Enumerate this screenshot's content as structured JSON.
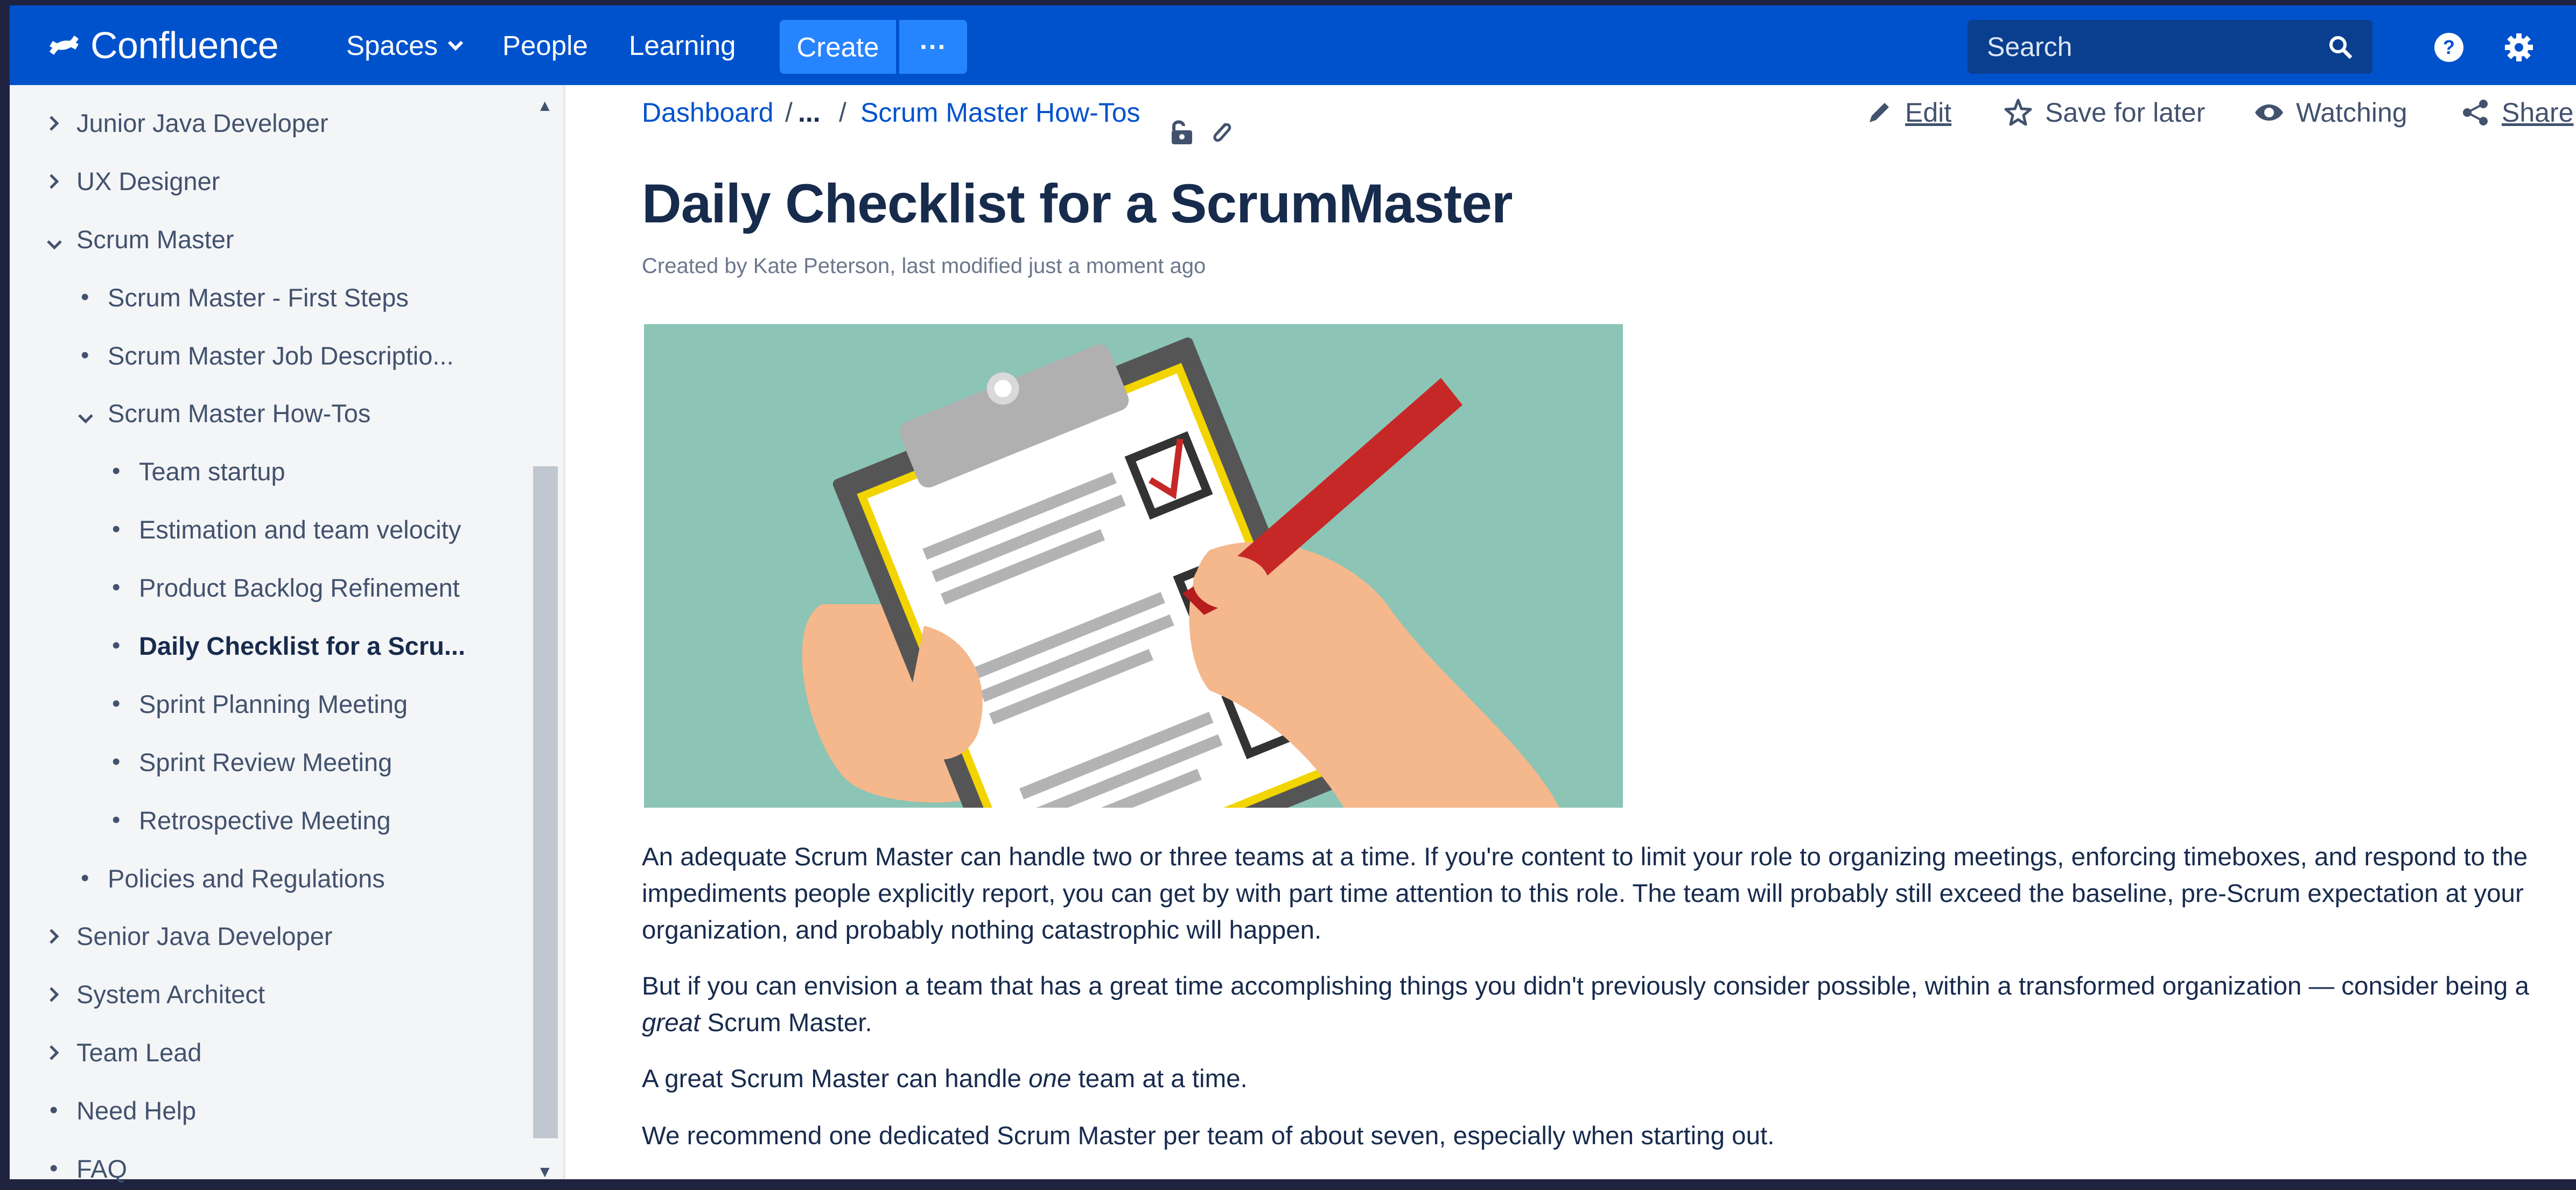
{
  "app": {
    "name": "Confluence",
    "brand_color": "#0052cc",
    "accent_color": "#2684ff"
  },
  "topnav": {
    "items": [
      {
        "label": "Spaces",
        "has_dropdown": true
      },
      {
        "label": "People"
      },
      {
        "label": "Learning"
      }
    ],
    "create_label": "Create",
    "more_label": "···",
    "search_placeholder": "Search",
    "icons": [
      "search-icon",
      "help-icon",
      "settings-icon"
    ]
  },
  "sidebar": {
    "items": [
      {
        "label": "Junior Java Developer",
        "marker": "chevron-right"
      },
      {
        "label": "UX Designer",
        "marker": "chevron-right"
      },
      {
        "label": "Scrum Master",
        "marker": "chevron-down"
      },
      {
        "label": "Scrum Master - First Steps",
        "marker": "bullet"
      },
      {
        "label": "Scrum Master Job Descriptio...",
        "marker": "bullet"
      },
      {
        "label": "Scrum Master How-Tos",
        "marker": "chevron-down"
      },
      {
        "label": "Team startup",
        "marker": "bullet"
      },
      {
        "label": "Estimation and team velocity",
        "marker": "bullet"
      },
      {
        "label": "Product Backlog Refinement",
        "marker": "bullet"
      },
      {
        "label": "Daily Checklist for a Scru...",
        "marker": "bullet",
        "current": true
      },
      {
        "label": "Sprint Planning Meeting",
        "marker": "bullet"
      },
      {
        "label": "Sprint Review Meeting",
        "marker": "bullet"
      },
      {
        "label": "Retrospective Meeting",
        "marker": "bullet"
      },
      {
        "label": "Policies and Regulations",
        "marker": "bullet"
      },
      {
        "label": "Senior Java Developer",
        "marker": "chevron-right"
      },
      {
        "label": "System Architect",
        "marker": "chevron-right"
      },
      {
        "label": "Team Lead",
        "marker": "chevron-right"
      },
      {
        "label": "Need Help",
        "marker": "bullet"
      },
      {
        "label": "FAQ",
        "marker": "bullet"
      }
    ]
  },
  "breadcrumb": {
    "items": [
      "Dashboard",
      "...",
      "Scrum Master How-Tos"
    ],
    "separator": "/"
  },
  "page_actions": {
    "edit": "Edit",
    "save_for_later": "Save for later",
    "watching": "Watching",
    "share": "Share"
  },
  "page": {
    "title": "Daily Checklist for a ScrumMaster",
    "byline": "Created by Kate Peterson, last modified just a moment ago",
    "paragraphs": [
      "An adequate Scrum Master can handle two or three teams at a time. If you're content to limit your role to organizing meetings, enforcing timeboxes, and respond to the impediments people explicitly report, you can get by with part time attention to this role. The team will probably still exceed the baseline, pre-Scrum expectation at your organization, and probably nothing catastrophic will happen.",
      "But if you can envision a team that has a great time accomplishing things you didn't previously consider possible, within a transformed organization — consider being a great Scrum Master.",
      "A great Scrum Master can handle one team at a time.",
      "We recommend one dedicated Scrum Master per team of about seven, especially when starting out."
    ]
  }
}
